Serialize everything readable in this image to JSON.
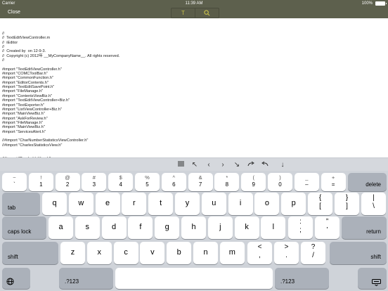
{
  "statusbar": {
    "carrier": "Carrier",
    "time": "11:39 AM",
    "battery": "100%"
  },
  "navbar": {
    "close_label": "Close",
    "text_tool": "T",
    "search_tool": "search-icon"
  },
  "editor": {
    "lines": [
      "//",
      "//  TextEditViewController.m",
      "//  iEditor",
      "//",
      "//  Created by  on 12-9-3.",
      "//  Copyright (c) 2012年 __MyCompanyName__. All rights reserved.",
      "//",
      "",
      "#import \"TextEditViewController.h\"",
      "#import \"COMCToolBar.h\"",
      "#import \"CommonFunction.h\"",
      "#import \"EditorContents.h\"",
      "#import \"TextEditSavePoint.h\"",
      "#import \"FileManage.h\"",
      "#import \"ContentsViewBiz.h\"",
      "#import \"TextEditViewController+Biz.h\"",
      "#import \"TextExporter.h\"",
      "#import \"ListViewController+Biz.h\"",
      "#import \"MainViewBiz.h\"",
      "#import \"AskForReview.h\"",
      "#import \"FileManage.h\"",
      "#import \"MainViewBiz.h\"",
      "#import \"ServicesAlert.h\"",
      "",
      "//#import \"CharNumberStatisticsViewController.h\"",
      "//#import \"CharlesStatisticsView.h\"",
      "",
      "",
      "//#import \"TouchableView.h\""
    ]
  },
  "accessory": {
    "buttons": [
      "list-icon",
      "↖",
      "‹",
      "›",
      "↘",
      "redo-icon",
      "undo-icon",
      "↑",
      "↓"
    ]
  },
  "keyboard": {
    "numrow": [
      {
        "top": "~",
        "bottom": "`"
      },
      {
        "top": "!",
        "bottom": "1"
      },
      {
        "top": "@",
        "bottom": "2"
      },
      {
        "top": "#",
        "bottom": "3"
      },
      {
        "top": "$",
        "bottom": "4"
      },
      {
        "top": "%",
        "bottom": "5"
      },
      {
        "top": "^",
        "bottom": "6"
      },
      {
        "top": "&",
        "bottom": "7"
      },
      {
        "top": "*",
        "bottom": "8"
      },
      {
        "top": "(",
        "bottom": "9"
      },
      {
        "top": ")",
        "bottom": "0"
      },
      {
        "top": "_",
        "bottom": "–"
      },
      {
        "top": "+",
        "bottom": "="
      }
    ],
    "delete_label": "delete",
    "tab_label": "tab",
    "row1": [
      "q",
      "w",
      "e",
      "r",
      "t",
      "y",
      "u",
      "i",
      "o",
      "p"
    ],
    "row1_sym": [
      {
        "top": "{",
        "bottom": "["
      },
      {
        "top": "}",
        "bottom": "]"
      },
      {
        "top": "|",
        "bottom": "\\"
      }
    ],
    "caps_label": "caps lock",
    "row2": [
      "a",
      "s",
      "d",
      "f",
      "g",
      "h",
      "j",
      "k",
      "l"
    ],
    "row2_sym": [
      {
        "top": ":",
        "bottom": ";"
      },
      {
        "top": "”",
        "bottom": "’"
      }
    ],
    "return_label": "return",
    "shift_label": "shift",
    "row3": [
      "z",
      "x",
      "c",
      "v",
      "b",
      "n",
      "m"
    ],
    "row3_sym": [
      {
        "top": "<",
        "bottom": ","
      },
      {
        "top": ">",
        "bottom": "."
      },
      {
        "top": "?",
        "bottom": "/"
      }
    ],
    "globe": "globe-icon",
    "mode_label": ".?123",
    "hide": "keyboard-hide-icon"
  },
  "colors": {
    "bar": "#5d604d",
    "accent": "#c9c14a",
    "keyboard_bg": "#cfd3d9",
    "dark_key": "#abb1ba"
  }
}
